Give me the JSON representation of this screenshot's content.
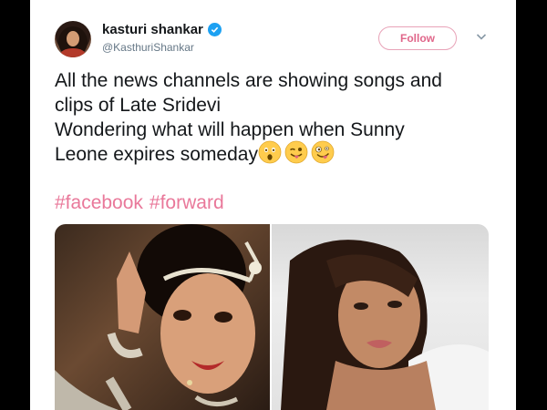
{
  "tweet": {
    "display_name": "kasturi shankar",
    "handle": "@KasthuriShankar",
    "follow_label": "Follow",
    "text_lines": [
      "All the news channels are showing songs and",
      "clips of Late Sridevi",
      "Wondering what will happen when Sunny",
      "Leone expires someday"
    ],
    "emojis": [
      "astonished-face",
      "winking-face-with-tongue",
      "zany-face"
    ],
    "hashtags": [
      "#facebook",
      "#forward"
    ]
  },
  "colors": {
    "hashtag": "#e9789a",
    "follow_border": "#e8a3b8",
    "verified": "#1da1f2",
    "background": "#000000"
  },
  "icons": [
    "verified-badge-icon",
    "chevron-down-icon"
  ]
}
